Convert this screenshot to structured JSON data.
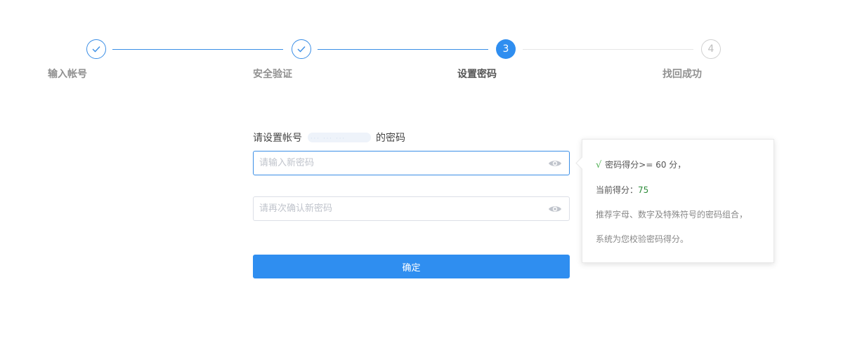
{
  "steps": [
    {
      "label": "输入帐号",
      "state": "done",
      "number": "1"
    },
    {
      "label": "安全验证",
      "state": "done",
      "number": "2"
    },
    {
      "label": "设置密码",
      "state": "active",
      "number": "3"
    },
    {
      "label": "找回成功",
      "state": "todo",
      "number": "4"
    }
  ],
  "form": {
    "title_prefix": "请设置帐号",
    "masked_account": "··· ··· ···",
    "title_suffix": "的密码",
    "new_password_placeholder": "请输入新密码",
    "confirm_password_placeholder": "请再次确认新密码",
    "submit_label": "确定"
  },
  "tooltip": {
    "check_mark": "√",
    "requirement": "密码得分>= 60 分，",
    "current_label": "当前得分：",
    "current_score": "75",
    "hint_line1": "推荐字母、数字及特殊符号的密码组合，",
    "hint_line2": "系统为您校验密码得分。"
  },
  "colors": {
    "accent": "#2f8ef0",
    "done_line": "#3a8ee6",
    "todo_line": "#e6e6e6",
    "score_ok": "#2e8b3a"
  },
  "icons": {
    "step_done": "check-icon",
    "password_toggle": "eye-icon"
  }
}
